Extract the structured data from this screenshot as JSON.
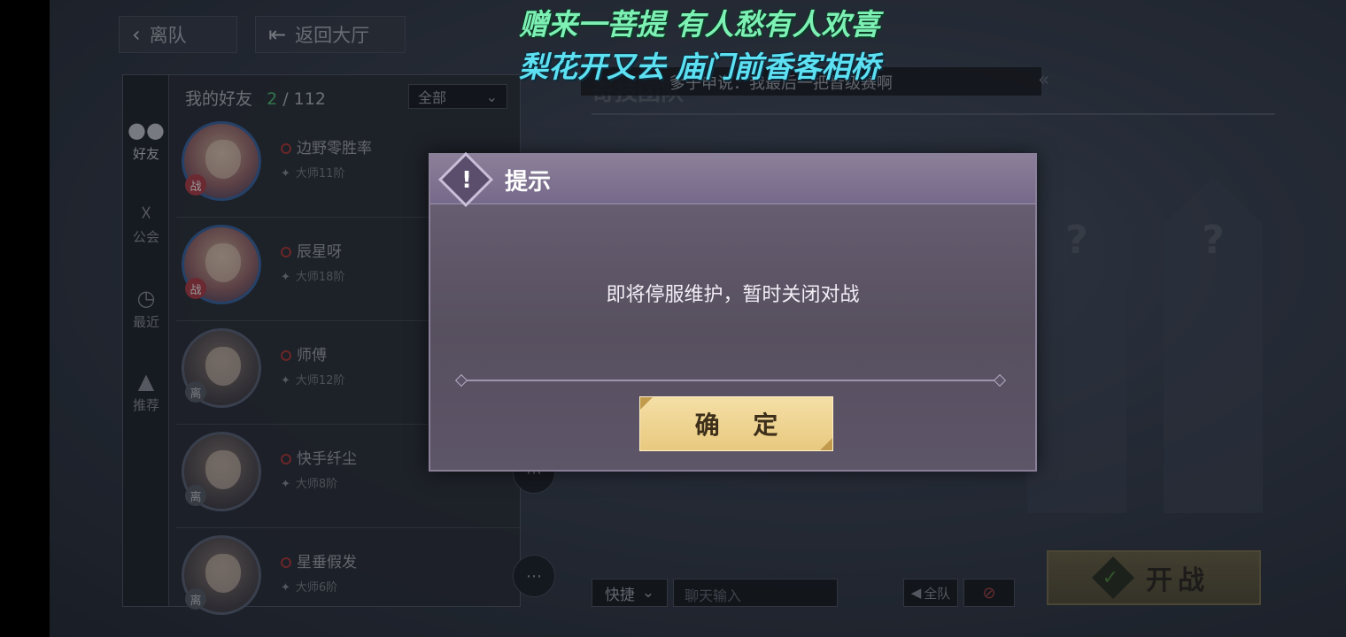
{
  "top_bar": {
    "leave_team_label": "离队",
    "back_lobby_label": "返回大厅"
  },
  "friends_panel": {
    "header_label": "我的好友",
    "online_count": "2",
    "total_count": "/ 112",
    "filter_value": "全部",
    "side_tabs": [
      {
        "label": "好友",
        "icon": "friends-icon"
      },
      {
        "label": "公会",
        "icon": "guild-icon"
      },
      {
        "label": "最近",
        "icon": "clock-icon"
      },
      {
        "label": "推荐",
        "icon": "thumbs-up-icon"
      }
    ],
    "friends": [
      {
        "name": "边野零胜率",
        "rank": "大师11阶",
        "status": "战",
        "online": true
      },
      {
        "name": "辰星呀",
        "rank": "大师18阶",
        "status": "战",
        "online": true
      },
      {
        "name": "师傅",
        "rank": "大师12阶",
        "status": "离",
        "online": false
      },
      {
        "name": "快手纤尘",
        "rank": "大师8阶",
        "status": "离",
        "online": false
      },
      {
        "name": "星垂假发",
        "rank": "大师6阶",
        "status": "离",
        "online": false
      }
    ]
  },
  "ticker": {
    "bg_title": "奇技团队",
    "message": "爹子申说：我最后一把晋级赛啊"
  },
  "slots": [
    "?",
    "?"
  ],
  "bottom": {
    "quick_label": "快捷",
    "chat_placeholder": "聊天输入",
    "team_voice_label": "全队",
    "start_label": "开战"
  },
  "dialog": {
    "title": "提示",
    "message": "即将停服维护，暂时关闭对战",
    "confirm_label": "确 定"
  },
  "lyrics": {
    "line1": "赠来一菩提 有人愁有人欢喜",
    "line2": "梨花开又去 庙门前香客相桥"
  }
}
